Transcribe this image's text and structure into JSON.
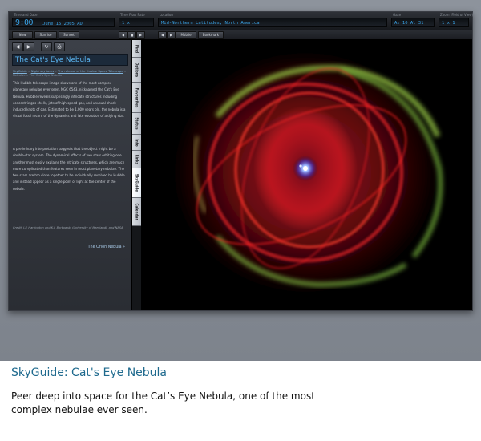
{
  "toolbar": {
    "time_label": "Time and Date",
    "time": "9:00",
    "date": "June 15 2005 AD",
    "rate_label": "Time Flow Rate",
    "rate": "1 x",
    "location_label": "Location",
    "location": "Mid-Northern Latitudes, North America",
    "coords_label": "Gaze",
    "coords": "Az 10  Al 31",
    "zoom_label": "Zoom (Field of View)",
    "zoom": "1 x 1"
  },
  "buttons": {
    "now": "Now",
    "sunrise": "Sunrise",
    "sunset": "Sunset",
    "back": "◀",
    "stop": "■",
    "forward": "▶",
    "mobile": "Mobile",
    "bookmark": "Bookmark"
  },
  "panel": {
    "title": "The Cat's Eye Nebula",
    "breadcrumb_link1": "SkyGuide",
    "breadcrumb_link2": "Night sky tours",
    "breadcrumb_link3": "The release of the Hubble Space Telescope",
    "breadcrumb_rest": "Nebulae » The Cat's Eye Nebula",
    "paragraph1": "This Hubble telescope image shows one of the most complex planetary nebulae ever seen, NGC 6543, nicknamed the Cat's Eye Nebula. Hubble reveals surprisingly intricate structures including concentric gas shells, jets of high-speed gas, and unusual shock-induced knots of gas. Estimated to be 1,000 years old, the nebula is a visual fossil record of the dynamics and late evolution of a dying star.",
    "paragraph2": "A preliminary interpretation suggests that the object might be a double-star system. The dynamical effects of two stars orbiting one another most easily explains the intricate structures, which are much more complicated than features seen in most planetary nebulae. The two stars are too close together to be individually resolved by Hubble and instead appear as a single point of light at the center of the nebula.",
    "credit": "Credit: J.P. Harrington and K.J. Borkowski (University of Maryland), and NASA",
    "next_link": "The Orion Nebula »"
  },
  "tabs": [
    {
      "label": "Find"
    },
    {
      "label": "Options"
    },
    {
      "label": "Favourites"
    },
    {
      "label": "Status"
    },
    {
      "label": "Info"
    },
    {
      "label": "Links"
    },
    {
      "label": "SkyGuide"
    },
    {
      "label": "Calendar"
    }
  ],
  "caption": {
    "title": "SkyGuide: Cat's Eye Nebula",
    "description": "Peer deep into space for the Cat’s Eye Nebula, one of the most complex nebulae ever seen."
  },
  "colors": {
    "accent": "#39a3e6",
    "caption_title": "#1f6a8e"
  },
  "icons": {
    "back": "left-arrow-icon",
    "forward": "right-arrow-icon",
    "reload": "reload-icon",
    "print": "print-icon"
  }
}
